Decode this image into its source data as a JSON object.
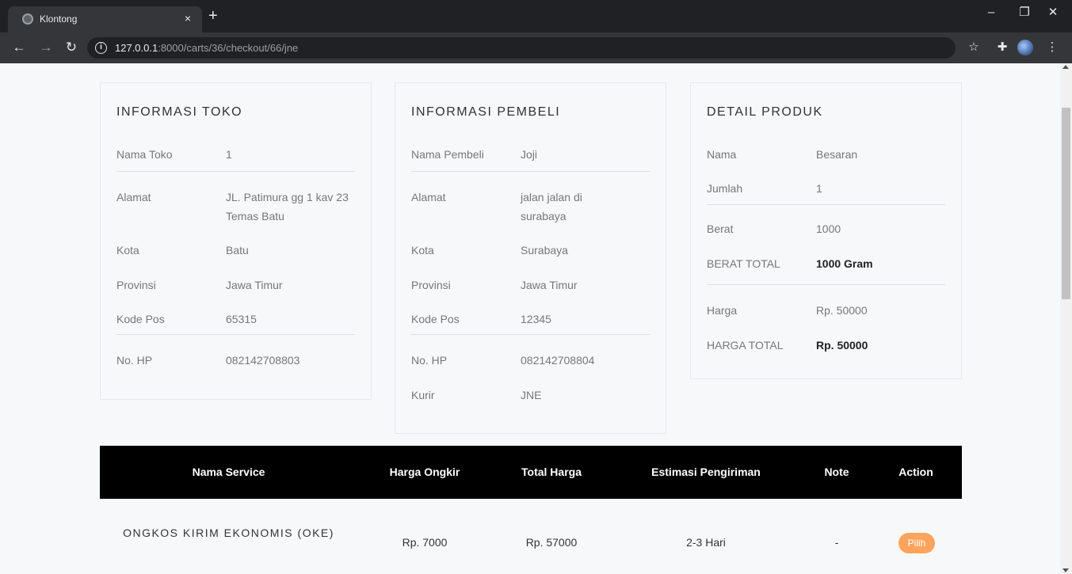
{
  "browser": {
    "tab_title": "Klontong",
    "tab_close": "×",
    "new_tab": "+",
    "url_host": "127.0.0.1",
    "url_rest": ":8000/carts/36/checkout/66/jne",
    "minimize": "–",
    "restore": "❐",
    "close": "✕"
  },
  "toko": {
    "title": "INFORMASI TOKO",
    "rows": [
      {
        "label": "Nama Toko",
        "value": "1"
      },
      {
        "label": "Alamat",
        "value": "JL. Patimura gg 1 kav 23 Temas Batu"
      },
      {
        "label": "Kota",
        "value": "Batu"
      },
      {
        "label": "Provinsi",
        "value": "Jawa Timur"
      },
      {
        "label": "Kode Pos",
        "value": "65315"
      },
      {
        "label": "No. HP",
        "value": "082142708803"
      }
    ]
  },
  "pembeli": {
    "title": "INFORMASI PEMBELI",
    "rows": [
      {
        "label": "Nama Pembeli",
        "value": "Joji"
      },
      {
        "label": "Alamat",
        "value": "jalan jalan di surabaya"
      },
      {
        "label": "Kota",
        "value": "Surabaya"
      },
      {
        "label": "Provinsi",
        "value": "Jawa Timur"
      },
      {
        "label": "Kode Pos",
        "value": "12345"
      },
      {
        "label": "No. HP",
        "value": "082142708804"
      },
      {
        "label": "Kurir",
        "value": "JNE"
      }
    ]
  },
  "produk": {
    "title": "DETAIL PRODUK",
    "rows": [
      {
        "label": "Nama",
        "value": "Besaran"
      },
      {
        "label": "Jumlah",
        "value": "1"
      },
      {
        "label": "Berat",
        "value": "1000"
      },
      {
        "label": "BERAT TOTAL",
        "value": "1000 Gram"
      },
      {
        "label": "Harga",
        "value": "Rp. 50000"
      },
      {
        "label": "HARGA TOTAL",
        "value": "Rp. 50000"
      }
    ]
  },
  "shipping": {
    "headers": [
      "Nama Service",
      "Harga Ongkir",
      "Total Harga",
      "Estimasi Pengiriman",
      "Note",
      "Action"
    ],
    "rows": [
      {
        "service": "ONGKOS KIRIM EKONOMIS (OKE)",
        "ongkir": "Rp. 7000",
        "total": "Rp. 57000",
        "estimasi": "2-3 Hari",
        "note": "-",
        "action": "Pilih"
      }
    ]
  }
}
